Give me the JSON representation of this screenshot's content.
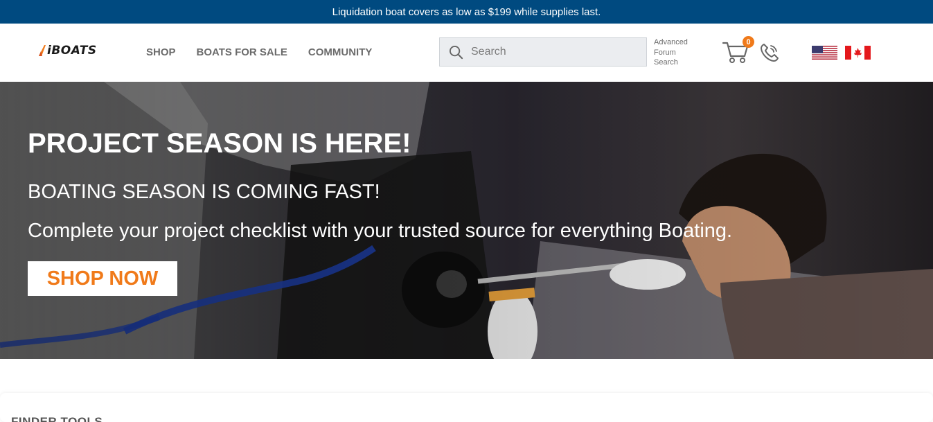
{
  "promo": {
    "text": "Liquidation boat covers as low as $199 while supplies last."
  },
  "header": {
    "logo_text": "iBOATS",
    "nav": [
      {
        "label": "SHOP"
      },
      {
        "label": "BOATS FOR SALE"
      },
      {
        "label": "COMMUNITY"
      }
    ],
    "search": {
      "placeholder": "Search",
      "value": ""
    },
    "advanced_search": {
      "line1": "Advanced",
      "line2": "Forum",
      "line3": "Search"
    },
    "cart": {
      "count": "0",
      "icon": "cart-icon"
    },
    "phone": {
      "icon": "phone-icon"
    },
    "flags": [
      {
        "icon": "us-flag-icon"
      },
      {
        "icon": "canada-flag-icon"
      }
    ]
  },
  "hero": {
    "title": "PROJECT SEASON IS HERE!",
    "subtitle": "BOATING SEASON IS COMING FAST!",
    "text": "Complete your project checklist with your trusted source for everything Boating.",
    "button_label": "SHOP NOW"
  },
  "finder": {
    "title": "FINDER TOOLS"
  },
  "colors": {
    "promo_bg": "#004a80",
    "accent": "#f07a1a",
    "nav_text": "#6b6b6b"
  }
}
